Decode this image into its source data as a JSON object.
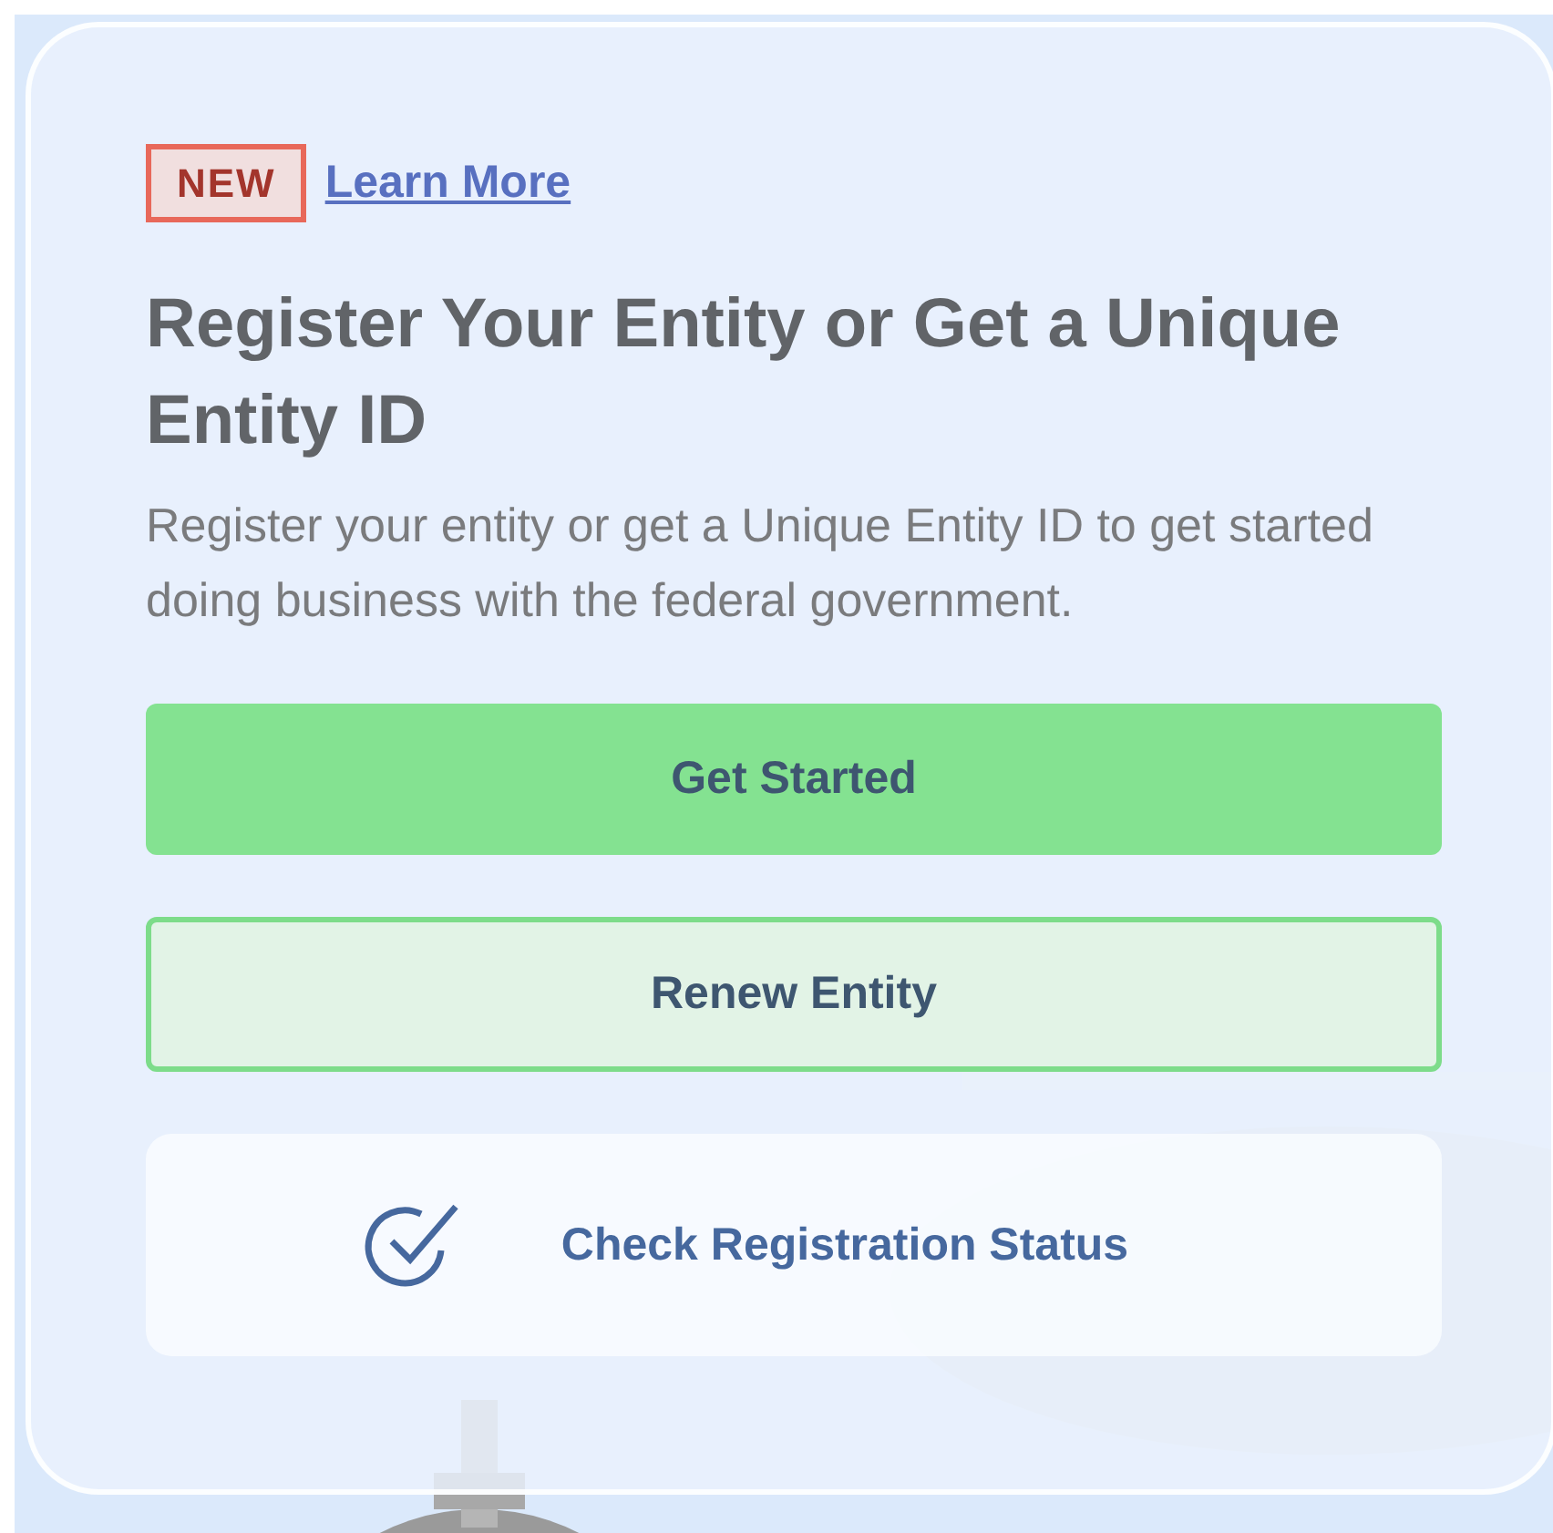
{
  "badge": "NEW",
  "learn_more_link": "Learn More",
  "heading": "Register Your Entity or Get a Unique Entity ID",
  "description": "Register your entity or get a Unique Entity ID to get started doing business with the federal government.",
  "buttons": [
    {
      "label": "Get Started",
      "kind": "primary"
    },
    {
      "label": "Renew Entity",
      "kind": "outline"
    },
    {
      "label": "Check Registration Status",
      "kind": "status"
    }
  ]
}
